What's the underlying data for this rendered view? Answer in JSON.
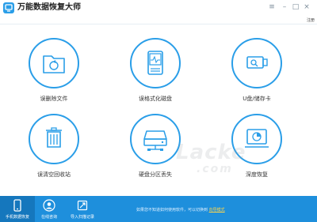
{
  "window": {
    "title": "万能数据恢复大师",
    "register_label": "注册",
    "controls": {
      "menu": "≡",
      "minimize": "–",
      "maximize": "□",
      "close": "×"
    }
  },
  "tiles": [
    {
      "label": "误删除文件",
      "icon": "folder-recover-icon"
    },
    {
      "label": "误格式化磁盘",
      "icon": "hard-disk-icon"
    },
    {
      "label": "U盘/储存卡",
      "icon": "usb-drive-icon"
    },
    {
      "label": "误清空回收站",
      "icon": "recycle-bin-icon"
    },
    {
      "label": "硬盘分区丢失",
      "icon": "partition-drive-icon"
    },
    {
      "label": "深度恢复",
      "icon": "deep-scan-icon"
    }
  ],
  "bottom_bar": {
    "items": [
      {
        "label": "手机数据恢复",
        "icon": "phone-icon"
      },
      {
        "label": "在线咨询",
        "icon": "user-consult-icon"
      },
      {
        "label": "导入扫描记录",
        "icon": "import-record-icon"
      }
    ],
    "hint_text": "如果您不知道如何使用软件，可以切换到",
    "hint_link": "向导模式"
  },
  "colors": {
    "accent": "#2a9ee8",
    "bottom_bar": "#1e8fdc",
    "bottom_bar_active": "#1577bd",
    "link": "#ffd54a"
  }
}
